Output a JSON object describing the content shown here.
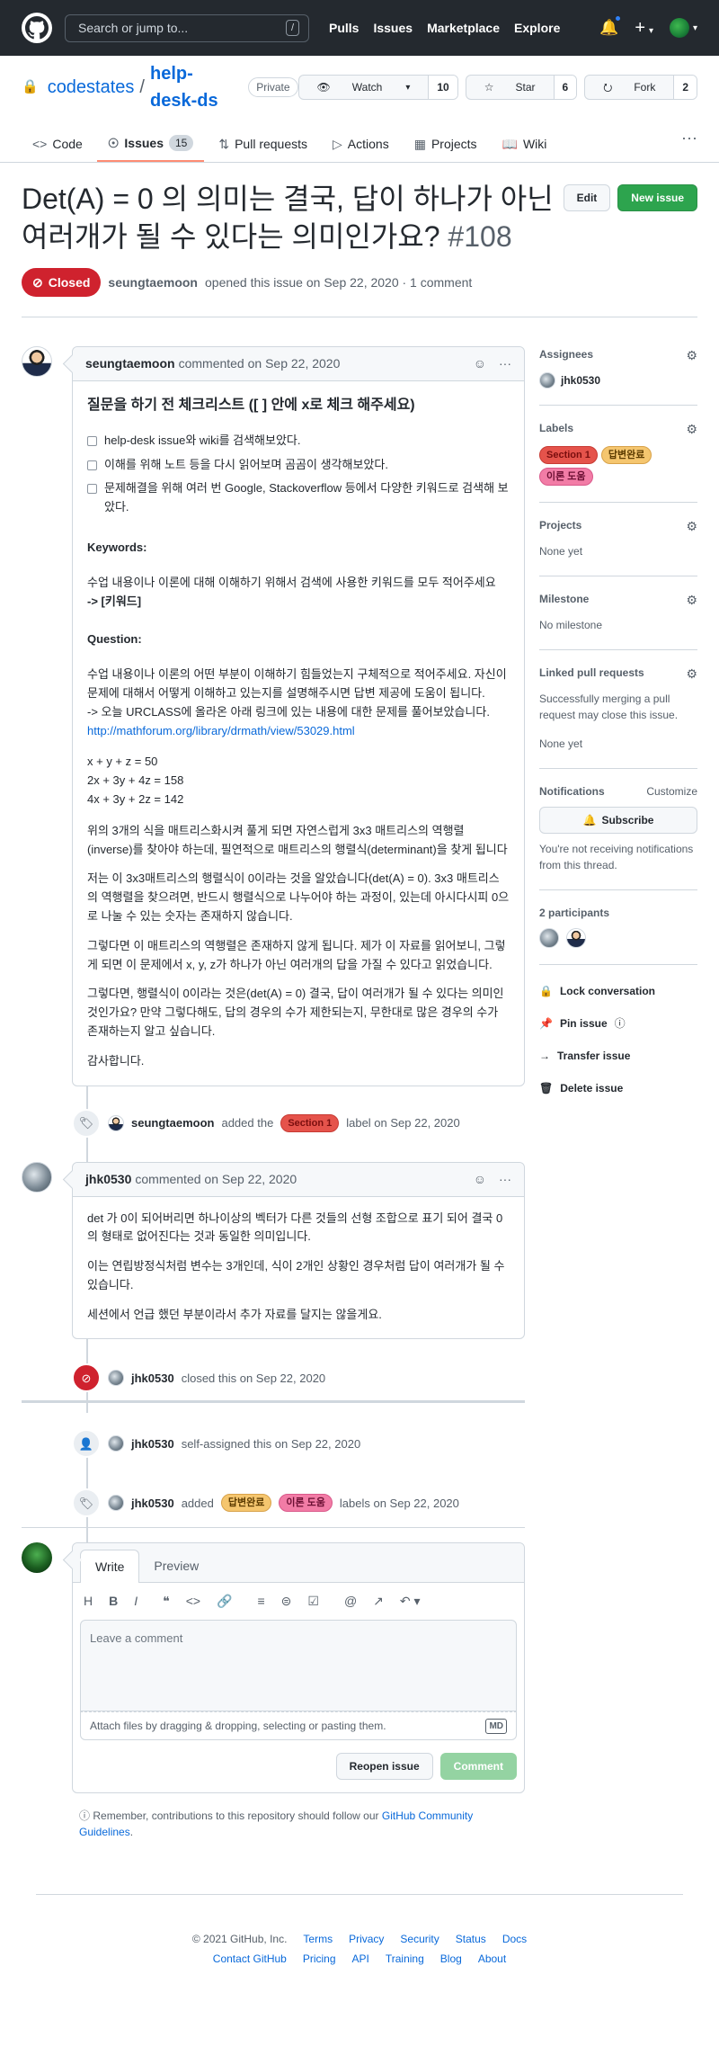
{
  "header": {
    "search_placeholder": "Search or jump to...",
    "slash_key": "/",
    "nav": [
      "Pulls",
      "Issues",
      "Marketplace",
      "Explore"
    ],
    "plus": "+"
  },
  "repo": {
    "owner": "codestates",
    "separator": "/",
    "name": "help-desk-ds",
    "visibility": "Private",
    "watch_label": "Watch",
    "watch_count": "10",
    "star_label": "Star",
    "star_count": "6",
    "fork_label": "Fork",
    "fork_count": "2",
    "tabs": [
      {
        "label": "Code",
        "icon": "code-icon"
      },
      {
        "label": "Issues",
        "icon": "issue-icon",
        "count": "15"
      },
      {
        "label": "Pull requests",
        "icon": "pull-request-icon"
      },
      {
        "label": "Actions",
        "icon": "play-icon"
      },
      {
        "label": "Projects",
        "icon": "project-icon"
      },
      {
        "label": "Wiki",
        "icon": "book-icon"
      }
    ]
  },
  "issue": {
    "title": "Det(A) = 0 의 의미는 결국, 답이 하나가 아닌 여러개가 될 수 있다는 의미인가요?",
    "number": "#108",
    "edit_label": "Edit",
    "new_issue_label": "New issue",
    "state": "Closed",
    "author": "seungtaemoon",
    "meta_text": "opened this issue on Sep 22, 2020 · 1 comment"
  },
  "comment1": {
    "author": "seungtaemoon",
    "action": "commented on Sep 22, 2020",
    "heading": "질문을 하기 전 체크리스트 ([ ] 안에 x로 체크 해주세요)",
    "checklist": [
      "help-desk issue와 wiki를 검색해보았다.",
      "이해를 위해 노트 등을 다시 읽어보며 곰곰이 생각해보았다.",
      "문제해결을 위해 여러 번 Google, Stackoverflow 등에서 다양한 키워드로 검색해 보았다."
    ],
    "keywords_title": "Keywords:",
    "keywords_text": "수업 내용이나 이론에 대해 이해하기 위해서 검색에 사용한 키워드를 모두 적어주세요",
    "keywords_value": "-> [키워드]",
    "question_title": "Question:",
    "question_text": "수업 내용이나 이론의 어떤 부분이 이해하기 힘들었는지 구체적으로 적어주세요. 자신이 문제에 대해서 어떻게 이해하고 있는지를 설명해주시면 답변 제공에 도움이 됩니다.",
    "question_text2": "-> 오늘 URCLASS에 올라온 아래 링크에 있는 내용에 대한 문제를 풀어보았습니다.",
    "link": "http://mathforum.org/library/drmath/view/53029.html",
    "eq1": "x + y + z = 50",
    "eq2": "2x + 3y + 4z = 158",
    "eq3": "4x + 3y + 2z = 142",
    "p1": "위의 3개의 식을 매트리스화시켜 풀게 되면 자연스럽게 3x3 매트리스의 역행렬(inverse)를 찾아야 하는데, 필연적으로 매트리스의 행렬식(determinant)을 찾게 됩니다",
    "p2": "저는 이 3x3매트리스의 행렬식이 0이라는 것을 알았습니다(det(A) = 0). 3x3 매트리스의 역행렬을 찾으려면, 반드시 행렬식으로 나누어야 하는 과정이, 있는데 아시다시피 0으로 나눌 수 있는 숫자는 존재하지 않습니다.",
    "p3": "그렇다면 이 매트리스의 역행렬은 존재하지 않게 됩니다. 제가 이 자료를 읽어보니, 그렇게 되면 이 문제에서 x, y, z가 하나가 아닌 여러개의 답을 가질 수 있다고 읽었습니다.",
    "p4": "그렇다면, 행렬식이 0이라는 것은(det(A) = 0) 결국, 답이 여러개가 될 수 있다는 의미인 것인가요? 만약 그렇다해도, 답의 경우의 수가 제한되는지, 무한대로 많은 경우의 수가 존재하는지 알고 싶습니다.",
    "p5": "감사합니다."
  },
  "event_label": {
    "actor": "seungtaemoon",
    "text1": "added the",
    "label": "Section 1",
    "text2": "label on Sep 22, 2020"
  },
  "comment2": {
    "author": "jhk0530",
    "action": "commented on Sep 22, 2020",
    "p1": "det 가 0이 되어버리면 하나이상의 벡터가 다른 것들의 선형 조합으로 표기 되어 결국 0의 형태로 없어진다는 것과 동일한 의미입니다.",
    "p2": "이는 연립방정식처럼 변수는 3개인데, 식이 2개인 상황인 경우처럼 답이 여러개가 될 수 있습니다.",
    "p3": "세션에서 언급 했던 부분이라서 추가 자료를 달지는 않을게요."
  },
  "event_closed": {
    "actor": "jhk0530",
    "text": "closed this on Sep 22, 2020"
  },
  "event_assigned": {
    "actor": "jhk0530",
    "text": "self-assigned this on Sep 22, 2020"
  },
  "event_labels": {
    "actor": "jhk0530",
    "text1": "added",
    "label1": "답변완료",
    "label2": "이론 도움",
    "text2": "labels on Sep 22, 2020"
  },
  "new_comment": {
    "tab_write": "Write",
    "tab_preview": "Preview",
    "placeholder": "Leave a comment",
    "attach": "Attach files by dragging & dropping, selecting or pasting them.",
    "md_badge": "MD",
    "reopen_label": "Reopen issue",
    "comment_label": "Comment",
    "note": "Remember, contributions to this repository should follow our",
    "note_link": "GitHub Community Guidelines",
    "note_end": "."
  },
  "sidebar": {
    "assignees_title": "Assignees",
    "assignee": "jhk0530",
    "labels_title": "Labels",
    "labels": [
      "Section 1",
      "답변완료",
      "이론 도움"
    ],
    "projects_title": "Projects",
    "projects_value": "None yet",
    "milestone_title": "Milestone",
    "milestone_value": "No milestone",
    "linked_title": "Linked pull requests",
    "linked_text": "Successfully merging a pull request may close this issue.",
    "linked_value": "None yet",
    "notifications_title": "Notifications",
    "customize": "Customize",
    "subscribe": "Subscribe",
    "notif_text": "You're not receiving notifications from this thread.",
    "participants_title": "2 participants",
    "lock": "Lock conversation",
    "pin": "Pin issue",
    "transfer": "Transfer issue",
    "delete": "Delete issue"
  },
  "footer": {
    "copyright": "© 2021 GitHub, Inc.",
    "row1": [
      "Terms",
      "Privacy",
      "Security",
      "Status",
      "Docs"
    ],
    "row2": [
      "Contact GitHub",
      "Pricing",
      "API",
      "Training",
      "Blog",
      "About"
    ]
  },
  "colors": {
    "closed": "#cf222e",
    "green": "#2da44e",
    "link": "#0969da",
    "header_bg": "#24292f"
  }
}
